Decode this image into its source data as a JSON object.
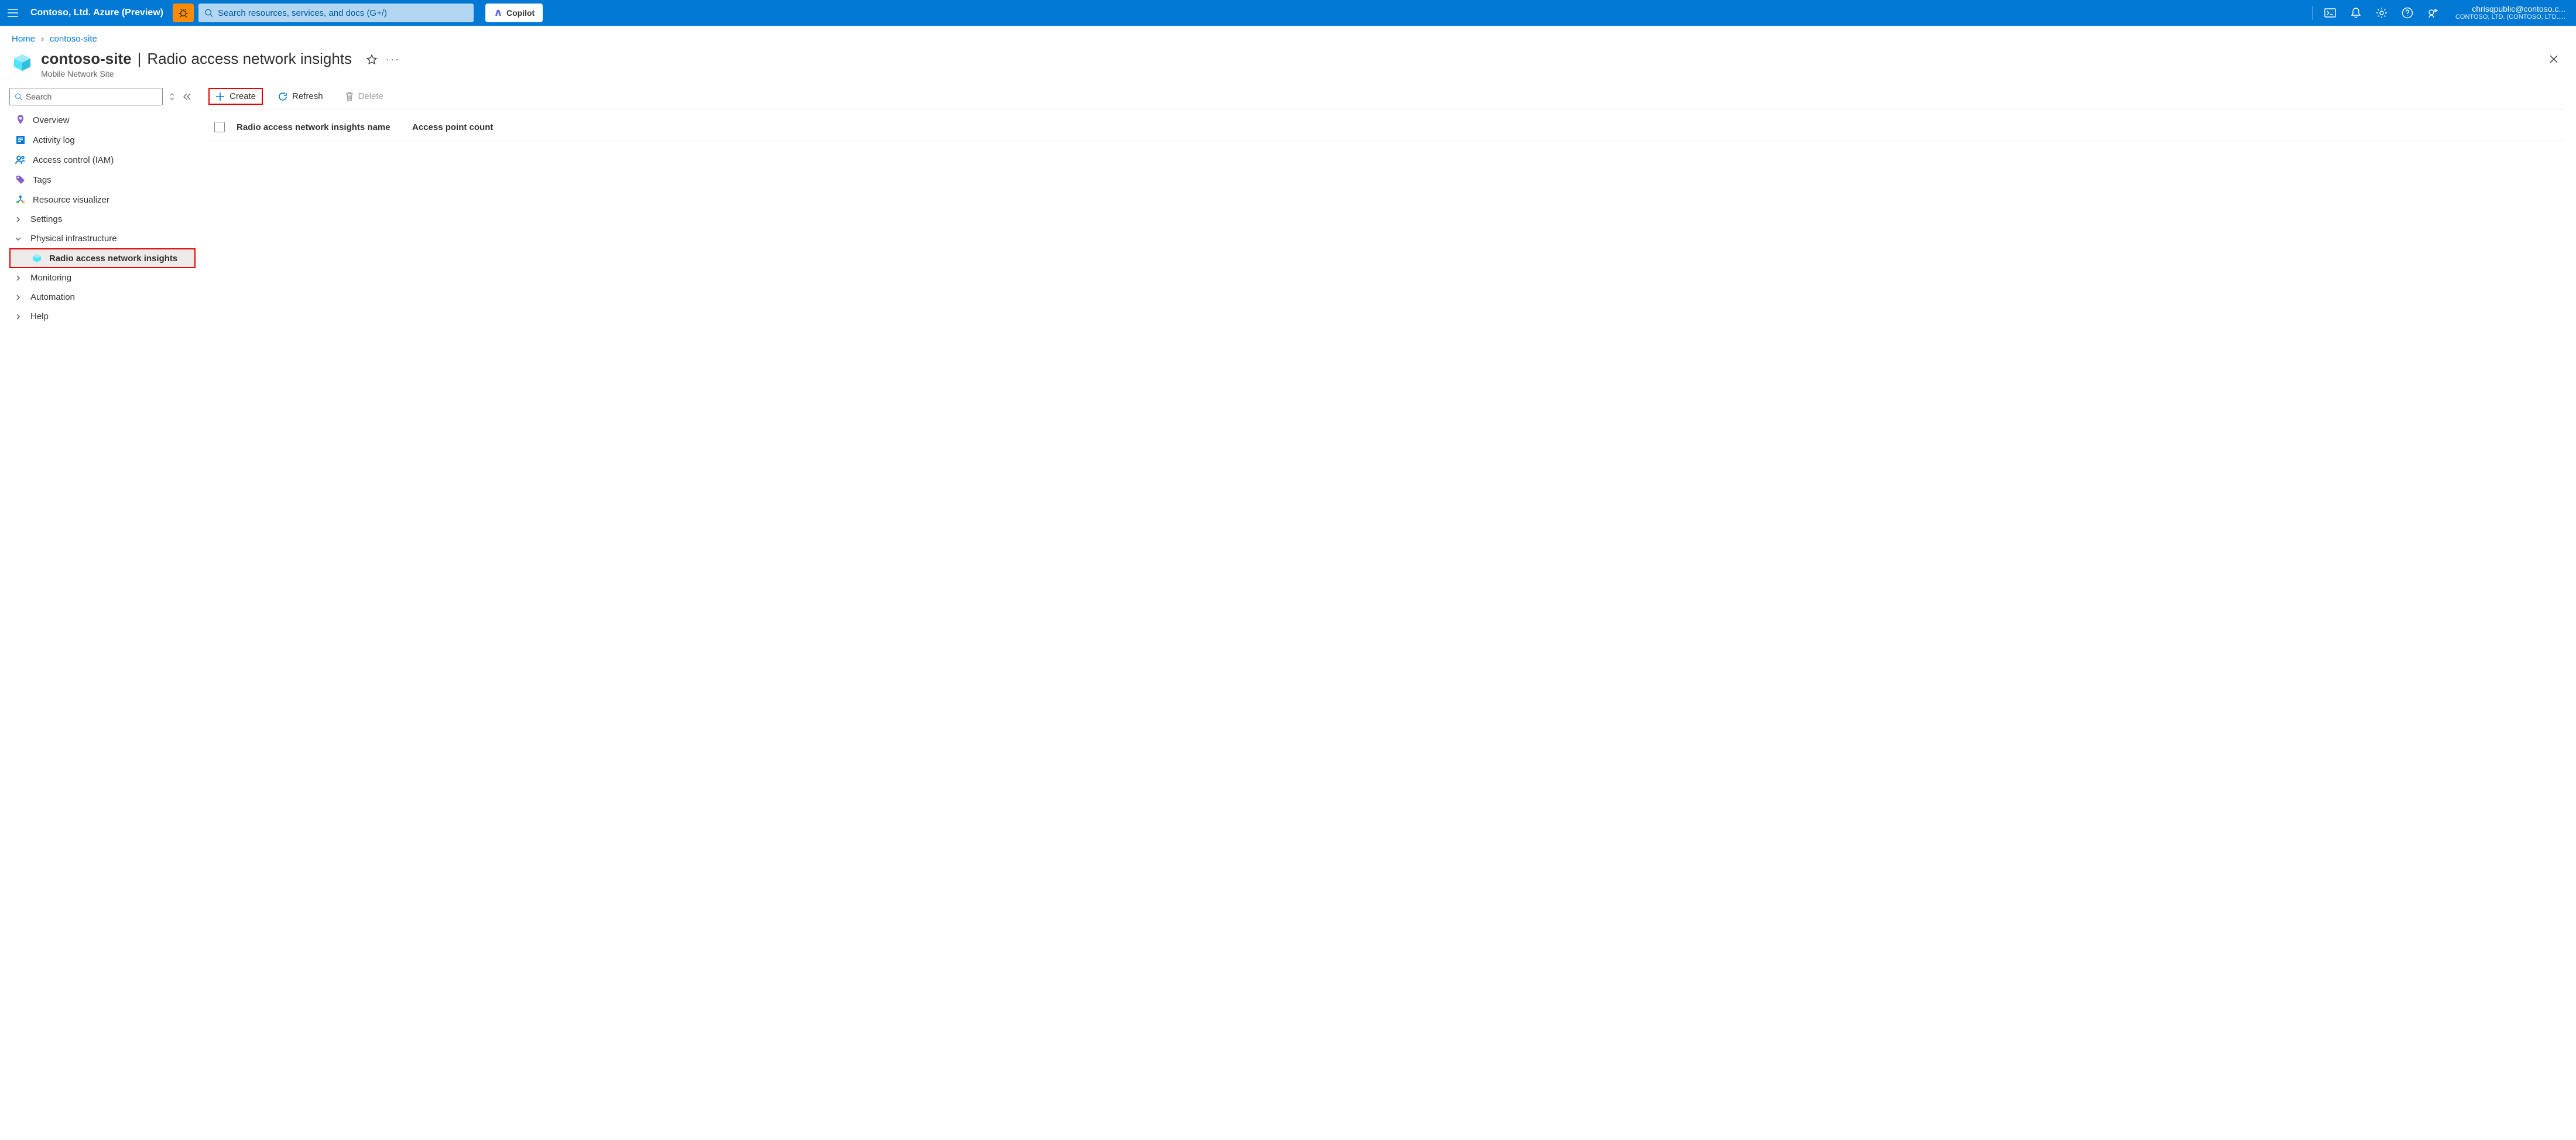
{
  "header": {
    "brand": "Contoso, Ltd. Azure (Preview)",
    "search_placeholder": "Search resources, services, and docs (G+/)",
    "copilot": "Copilot",
    "account_email": "chrisqpublic@contoso.c...",
    "account_tenant": "CONTOSO, LTD. (CONTOSO, LTD....."
  },
  "breadcrumb": {
    "items": [
      "Home",
      "contoso-site"
    ]
  },
  "page": {
    "title_bold": "contoso-site",
    "title_rest": "Radio access network insights",
    "subtitle": "Mobile Network Site"
  },
  "sidebar": {
    "search_placeholder": "Search",
    "items": {
      "overview": "Overview",
      "activity_log": "Activity log",
      "iam": "Access control (IAM)",
      "tags": "Tags",
      "visualizer": "Resource visualizer",
      "settings": "Settings",
      "physical": "Physical infrastructure",
      "rani": "Radio access network insights",
      "monitoring": "Monitoring",
      "automation": "Automation",
      "help": "Help"
    }
  },
  "toolbar": {
    "create": "Create",
    "refresh": "Refresh",
    "delete": "Delete"
  },
  "table": {
    "col_name": "Radio access network insights name",
    "col_count": "Access point count"
  }
}
